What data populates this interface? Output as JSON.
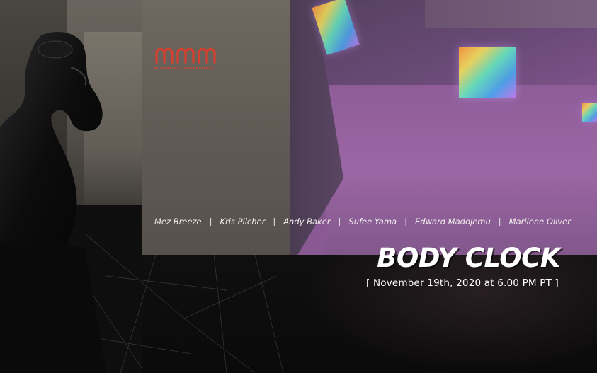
{
  "logo": {
    "mark": "mor",
    "name": "MUSEUM OF OTHER REALITIES",
    "color": "#d8402e"
  },
  "event": {
    "artists": [
      "Mez Breeze",
      "Kris Pilcher",
      "Andy Baker",
      "Sufee Yama",
      "Edward Madojemu",
      "Marilene Oliver"
    ],
    "separator": "|",
    "title": "BODY CLOCK",
    "date": "[ November 19th, 2020 at 6.00 PM PT ]"
  },
  "colors": {
    "accent": "#d8402e",
    "text": "#ffffff",
    "background": "#0d0c0d",
    "purple": "#8e5d98"
  },
  "icons": [
    "mor-logo-icon",
    "rainbow-cube-icon"
  ]
}
